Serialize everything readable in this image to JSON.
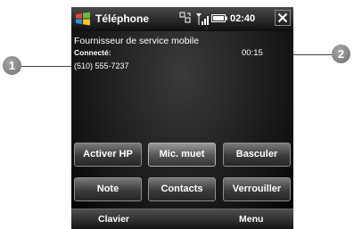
{
  "titlebar": {
    "title": "Téléphone",
    "time": "02:40",
    "icons": [
      "windows-start-icon",
      "network-icon",
      "signal-icon",
      "battery-icon",
      "close-icon"
    ]
  },
  "call": {
    "provider": "Fournisseur de service mobile",
    "status": "Connecté:",
    "number": "(510) 555-7237",
    "duration": "00:15"
  },
  "buttons": {
    "speaker": "Activer HP",
    "mute": "Mic. muet",
    "swap": "Basculer",
    "note": "Note",
    "contacts": "Contacts",
    "lock": "Verrouiller"
  },
  "softkeys": {
    "left": "Clavier",
    "right": "Menu"
  },
  "callouts": {
    "one": "1",
    "two": "2"
  }
}
